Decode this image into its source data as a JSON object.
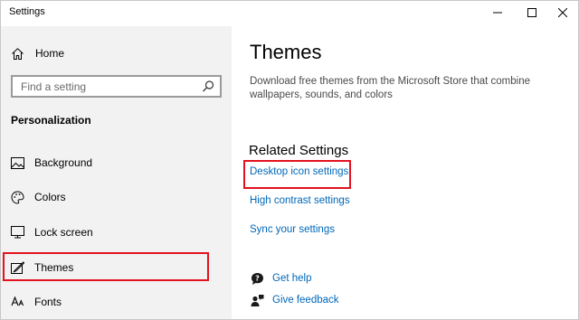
{
  "window": {
    "title": "Settings"
  },
  "sidebar": {
    "home_label": "Home",
    "search_placeholder": "Find a setting",
    "section_title": "Personalization",
    "items": [
      {
        "label": "Background",
        "icon": "picture-icon"
      },
      {
        "label": "Colors",
        "icon": "palette-icon"
      },
      {
        "label": "Lock screen",
        "icon": "monitor-icon"
      },
      {
        "label": "Themes",
        "icon": "brush-icon",
        "selected": true
      },
      {
        "label": "Fonts",
        "icon": "font-icon"
      }
    ]
  },
  "main": {
    "title": "Themes",
    "description": "Download free themes from the Microsoft Store that combine wallpapers, sounds, and colors",
    "related_title": "Related Settings",
    "links": [
      "Desktop icon settings",
      "High contrast settings",
      "Sync your settings"
    ],
    "help": {
      "get_help": "Get help",
      "give_feedback": "Give feedback"
    }
  },
  "colors": {
    "link": "#0067b8",
    "highlight_box": "#e3121f",
    "sidebar_bg": "#f2f2f2"
  }
}
